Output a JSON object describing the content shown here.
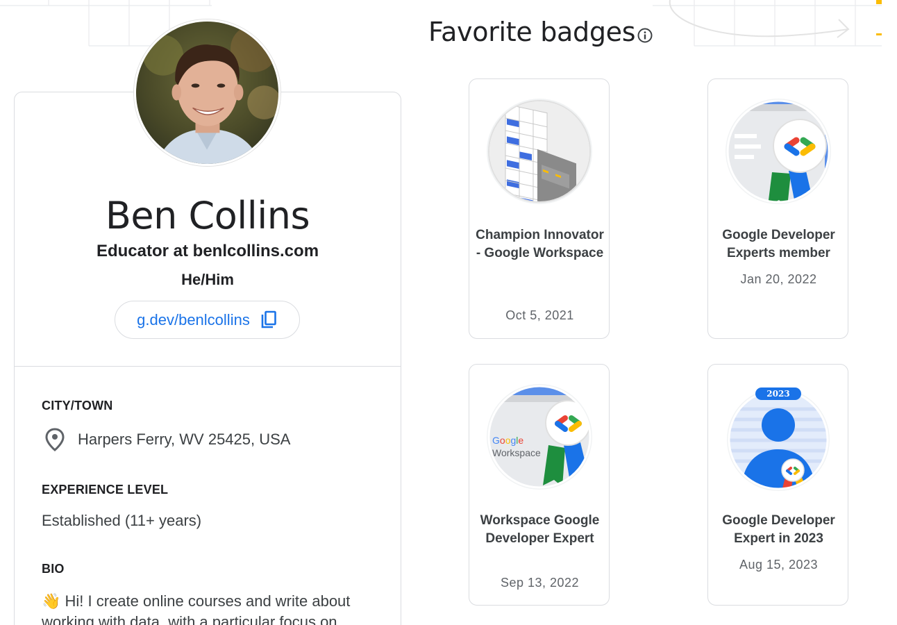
{
  "profile": {
    "name": "Ben Collins",
    "title": "Educator at benlcollins.com",
    "pronouns": "He/Him",
    "profile_link": "g.dev/benlcollins",
    "city_label": "CITY/TOWN",
    "city_value": "Harpers Ferry, WV 25425, USA",
    "experience_label": "EXPERIENCE LEVEL",
    "experience_value": "Established (11+ years)",
    "bio_label": "BIO",
    "bio_emoji": "👋",
    "bio_text": " Hi! I create online courses and write about working with data, with a particular focus on"
  },
  "favorites": {
    "heading": "Favorite badges",
    "badges": [
      {
        "name": "Champion Innovator - Google Workspace",
        "date": "Oct 5, 2021",
        "icon": "champion-innovator-workspace-badge"
      },
      {
        "name": "Google Developer Experts member",
        "date": "Jan 20, 2022",
        "icon": "gde-member-badge"
      },
      {
        "name": "Workspace Google Developer Expert",
        "date": "Sep 13, 2022",
        "icon": "workspace-gde-badge"
      },
      {
        "name": "Google Developer Expert in 2023",
        "date": "Aug 15, 2023",
        "icon": "gde-2023-badge"
      }
    ],
    "badge_2023_year": "2023",
    "workspace_logo_google": "Google",
    "workspace_logo_workspace": "Workspace"
  },
  "colors": {
    "link_blue": "#1a73e8",
    "google_blue": "#4285f4",
    "google_red": "#ea4335",
    "google_yellow": "#fbbc04",
    "google_green": "#34a853",
    "border": "#dadce0"
  }
}
